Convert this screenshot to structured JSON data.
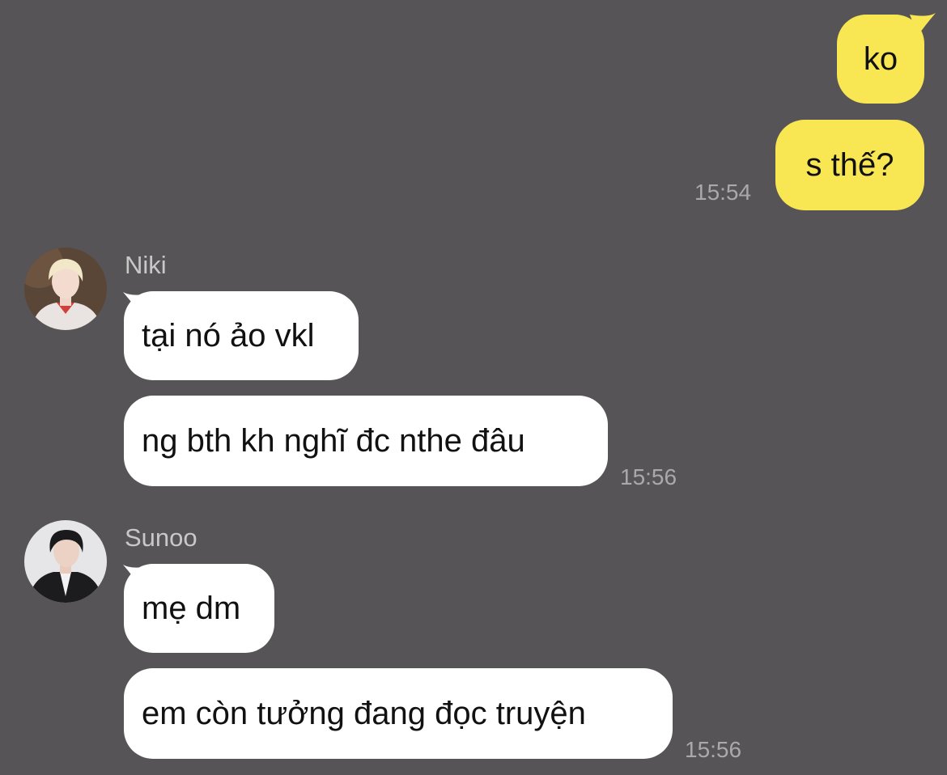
{
  "colors": {
    "background": "#565456",
    "outgoing_bubble": "#f8e653",
    "incoming_bubble": "#ffffff",
    "timestamp": "#a9a9a9",
    "sender_name": "#c8c8c8"
  },
  "chat": {
    "outgoing": {
      "messages": [
        "ko",
        "s thế?"
      ],
      "time": "15:54"
    },
    "groups": [
      {
        "sender": "Niki",
        "avatar_icon": "avatar-photo-icon",
        "messages": [
          "tại nó ảo vkl",
          "ng bth kh nghĩ đc nthe đâu"
        ],
        "time": "15:56"
      },
      {
        "sender": "Sunoo",
        "avatar_icon": "avatar-photo-icon",
        "messages": [
          "mẹ dm",
          "em còn tưởng đang đọc truyện"
        ],
        "time": "15:56"
      }
    ]
  }
}
